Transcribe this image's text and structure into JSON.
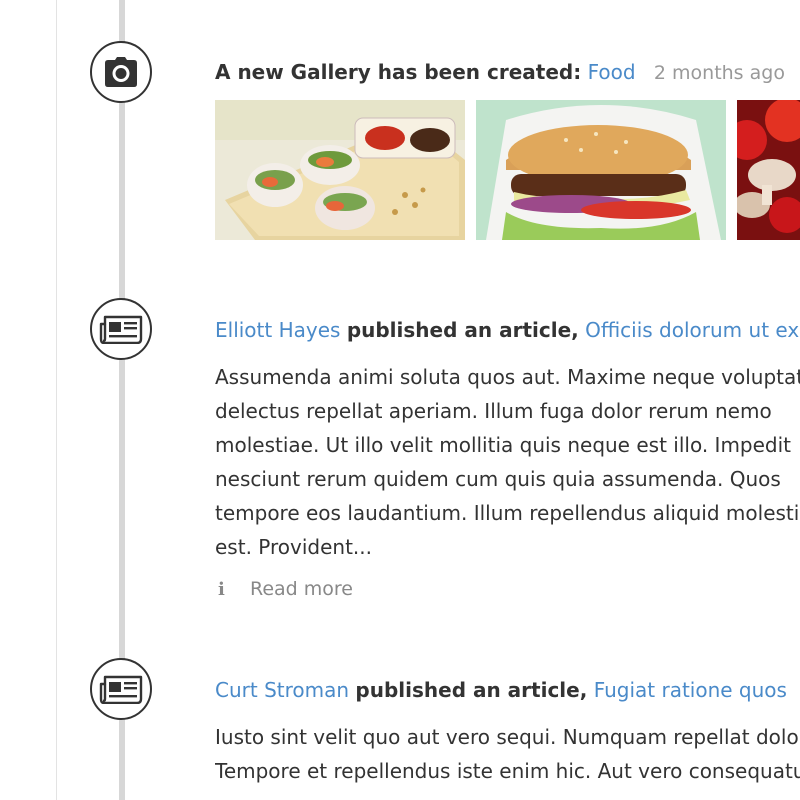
{
  "timeline": {
    "items": [
      {
        "icon": "camera-icon",
        "prefix": "A new Gallery has been created:",
        "gallery_link": "Food",
        "timestamp": "2 months ago",
        "thumbnails": [
          "spring-rolls-photo",
          "burger-photo",
          "tomatoes-mushrooms-photo"
        ]
      },
      {
        "icon": "newspaper-icon",
        "author": "Elliott Hayes",
        "action": "published an article,",
        "article_link": "Officiis dolorum ut ex",
        "excerpt_lines": [
          "Assumenda animi soluta quos aut. Maxime neque voluptatem",
          "delectus repellat aperiam. Illum fuga dolor rerum nemo",
          "molestiae. Ut illo velit mollitia quis neque est illo. Impedit",
          "nesciunt rerum quidem cum quis quia assumenda. Quos",
          "tempore eos laudantium. Illum repellendus aliquid molestiae",
          "est. Provident..."
        ],
        "read_more": "Read more"
      },
      {
        "icon": "newspaper-icon",
        "author": "Curt Stroman",
        "action": "published an article,",
        "article_link": "Fugiat ratione quos",
        "excerpt_lines": [
          "Iusto sint velit quo aut vero sequi. Numquam repellat dolor",
          "Tempore et repellendus iste enim hic. Aut vero consequatur"
        ]
      }
    ]
  },
  "colors": {
    "link": "#4a8ac9",
    "text": "#333333",
    "muted": "#999999",
    "timeline": "#d7d7d7"
  }
}
